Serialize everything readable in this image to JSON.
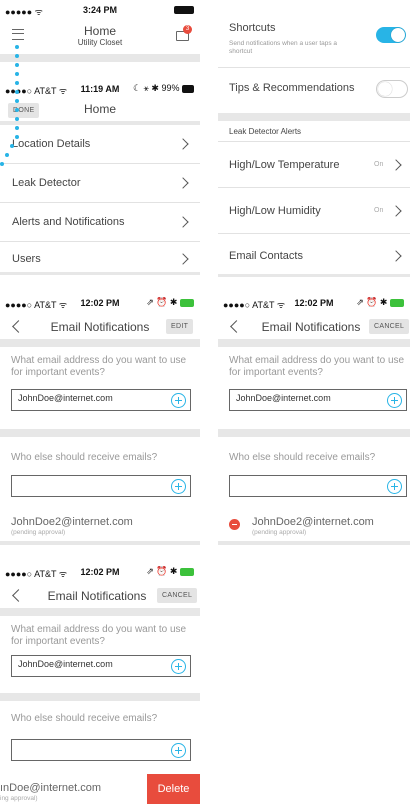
{
  "colors": {
    "accent": "#28b4e6",
    "delete": "#e84c3d",
    "separator": "#e7e7e7"
  },
  "panel1": {
    "status_signal": "●●●●● ᯤ",
    "status_time": "3:24 PM",
    "title": "Home",
    "subtitle": "Utility Closet",
    "notification_count": "3"
  },
  "panel1b": {
    "status_left": "●●●●○ AT&T ᯤ",
    "status_time": "11:19 AM",
    "status_right": "☾ ⚹ ✱ 99%",
    "done_label": "DONE",
    "title": "Home",
    "menu": [
      {
        "label": "Location Details"
      },
      {
        "label": "Leak Detector"
      },
      {
        "label": "Alerts and Notifications"
      },
      {
        "label": "Users"
      }
    ]
  },
  "panel2": {
    "shortcuts_label": "Shortcuts",
    "shortcuts_desc": "Send notifications when a user taps a shortcut",
    "shortcuts_on": true,
    "tips_label": "Tips & Recommendations",
    "tips_on": false,
    "section_header": "Leak Detector Alerts",
    "alerts": [
      {
        "label": "High/Low Temperature",
        "value": "On"
      },
      {
        "label": "High/Low Humidity",
        "value": "On"
      }
    ],
    "email_contacts": "Email Contacts"
  },
  "email_common": {
    "status_left": "●●●●○ AT&T ᯤ",
    "status_time": "12:02 PM",
    "status_right": "⇗ ⏰ ✱",
    "title": "Email Notifications",
    "question1": "What email address do you want to use for important events?",
    "email": "JohnDoe@internet.com",
    "question2": "Who else should receive emails?",
    "new_email_value": "",
    "email2": "JohnDoe2@internet.com",
    "pending": "(pending approval)"
  },
  "panel3": {
    "action_label": "EDIT"
  },
  "panel4": {
    "action_label": "CANCEL"
  },
  "panel5": {
    "action_label": "CANCEL",
    "email2_clipped": "ınDoe@internet.com",
    "pending_clipped": "ing approval)",
    "delete_label": "Delete"
  }
}
